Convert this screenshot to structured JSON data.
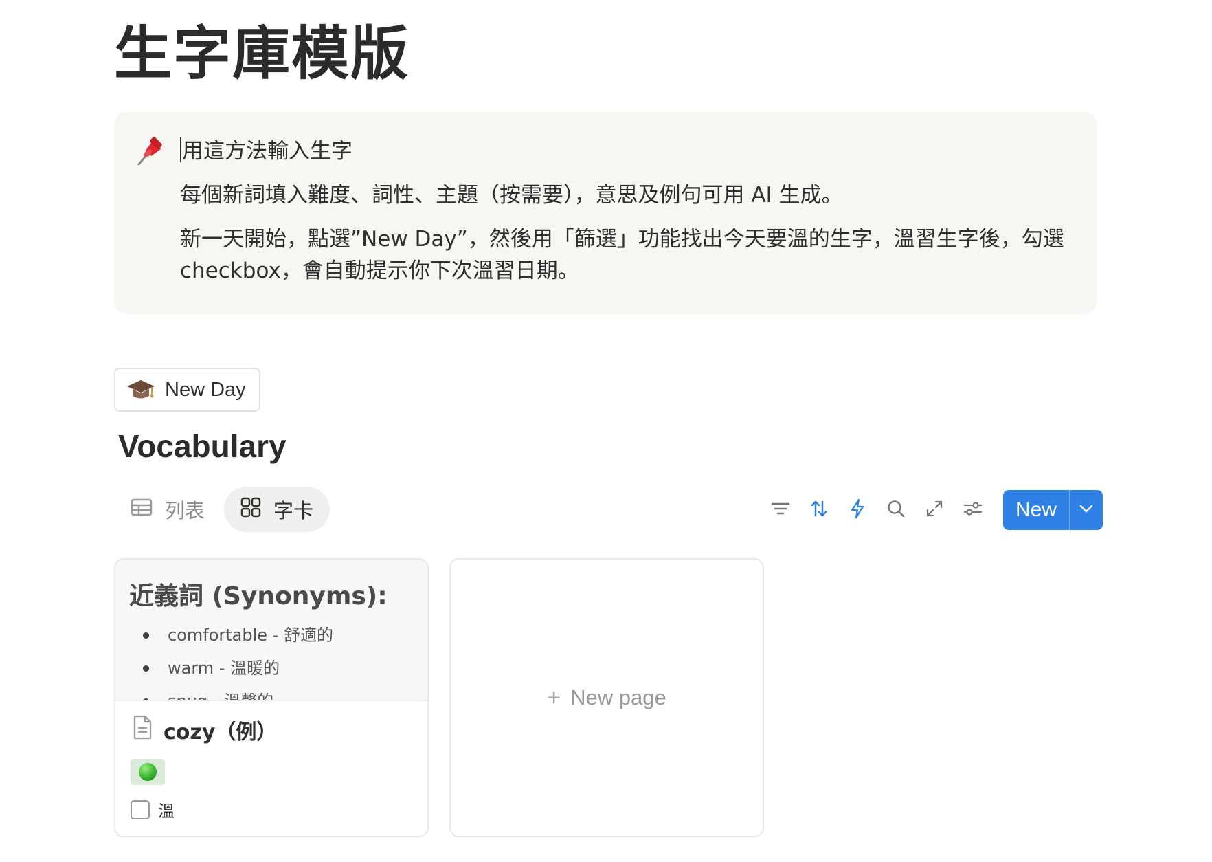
{
  "page": {
    "title": "生字庫模版"
  },
  "callout": {
    "icon": "pushpin-icon",
    "heading": "用這方法輸入生字",
    "line1": "每個新詞填入難度、詞性、主題（按需要），意思及例句可用 AI 生成。",
    "line2": "新一天開始，點選”New Day”，然後用「篩選」功能找出今天要溫的生字，溫習生字後，勾選checkbox，會自動提示你下次溫習日期。"
  },
  "button": {
    "icon": "graduation-cap-icon",
    "label": "New Day"
  },
  "database": {
    "title": "Vocabulary",
    "views": [
      {
        "label": "列表",
        "icon": "table-icon",
        "active": false
      },
      {
        "label": "字卡",
        "icon": "gallery-icon",
        "active": true
      }
    ],
    "toolbar": {
      "icons": [
        "filter-icon",
        "sort-icon",
        "automation-icon",
        "search-icon",
        "expand-icon",
        "settings-icon"
      ],
      "new_label": "New",
      "accent": "#2f80e4"
    }
  },
  "cards": [
    {
      "preview_heading": "近義詞 (Synonyms):",
      "preview_items": [
        "comfortable - 舒適的",
        "warm - 溫暖的",
        "snug - 溫馨的"
      ],
      "name": "cozy（例）",
      "tag_color": "#2fae2a",
      "checkbox_label": "溫",
      "checked": false
    }
  ],
  "new_page": {
    "label": "New page"
  }
}
